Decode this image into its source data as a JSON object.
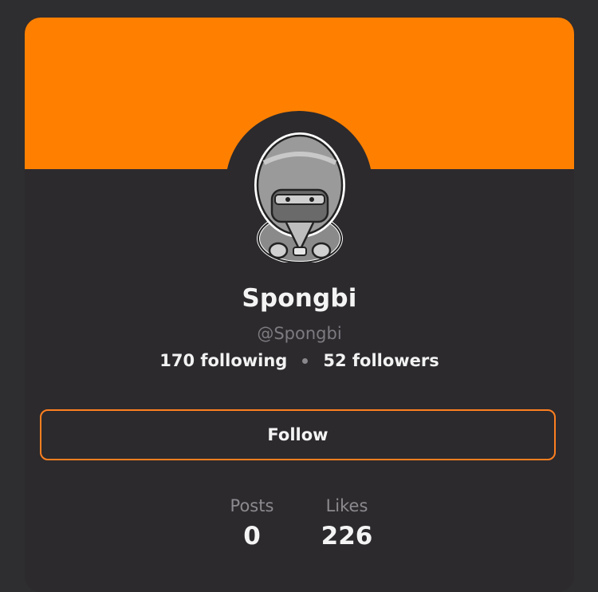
{
  "profile": {
    "display_name": "Spongbi",
    "handle": "@Spongbi",
    "following": "170 following",
    "followers": "52 followers",
    "banner_color": "#ff8000",
    "accent_color": "#ff7f1f"
  },
  "actions": {
    "follow_label": "Follow"
  },
  "counters": {
    "posts_label": "Posts",
    "posts_value": "0",
    "likes_label": "Likes",
    "likes_value": "226"
  }
}
